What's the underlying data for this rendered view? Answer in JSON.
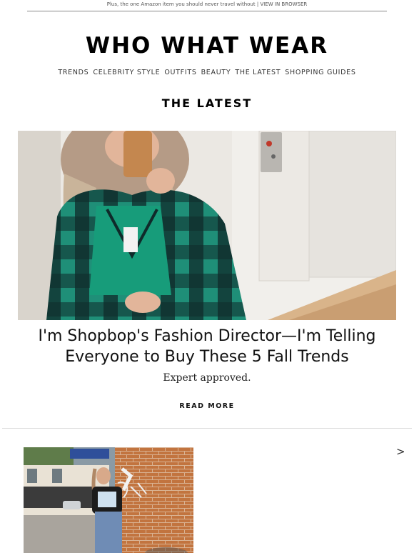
{
  "preheader": {
    "text": "Plus, the one Amazon item you should never travel without",
    "separator": "|",
    "view_in_browser": "VIEW IN BROWSER"
  },
  "brand": {
    "logo": "WHO WHAT WEAR"
  },
  "nav": {
    "items": [
      "TRENDS",
      "CELEBRITY STYLE",
      "OUTFITS",
      "BEAUTY",
      "THE LATEST",
      "SHOPPING GUIDES"
    ]
  },
  "section": {
    "title": "THE LATEST"
  },
  "article": {
    "headline": "I'm Shopbop's Fashion Director—I'm Telling Everyone to Buy These 5 Fall Trends",
    "dek": "Expert approved.",
    "cta": "READ MORE"
  },
  "carousel": {
    "next_icon": "chevron-right-icon",
    "next_glyph": ">"
  },
  "colors": {
    "text": "#111111",
    "divider": "#dddddd",
    "plaid_green": "#1f8f78",
    "plaid_dark": "#0f2a2a"
  }
}
